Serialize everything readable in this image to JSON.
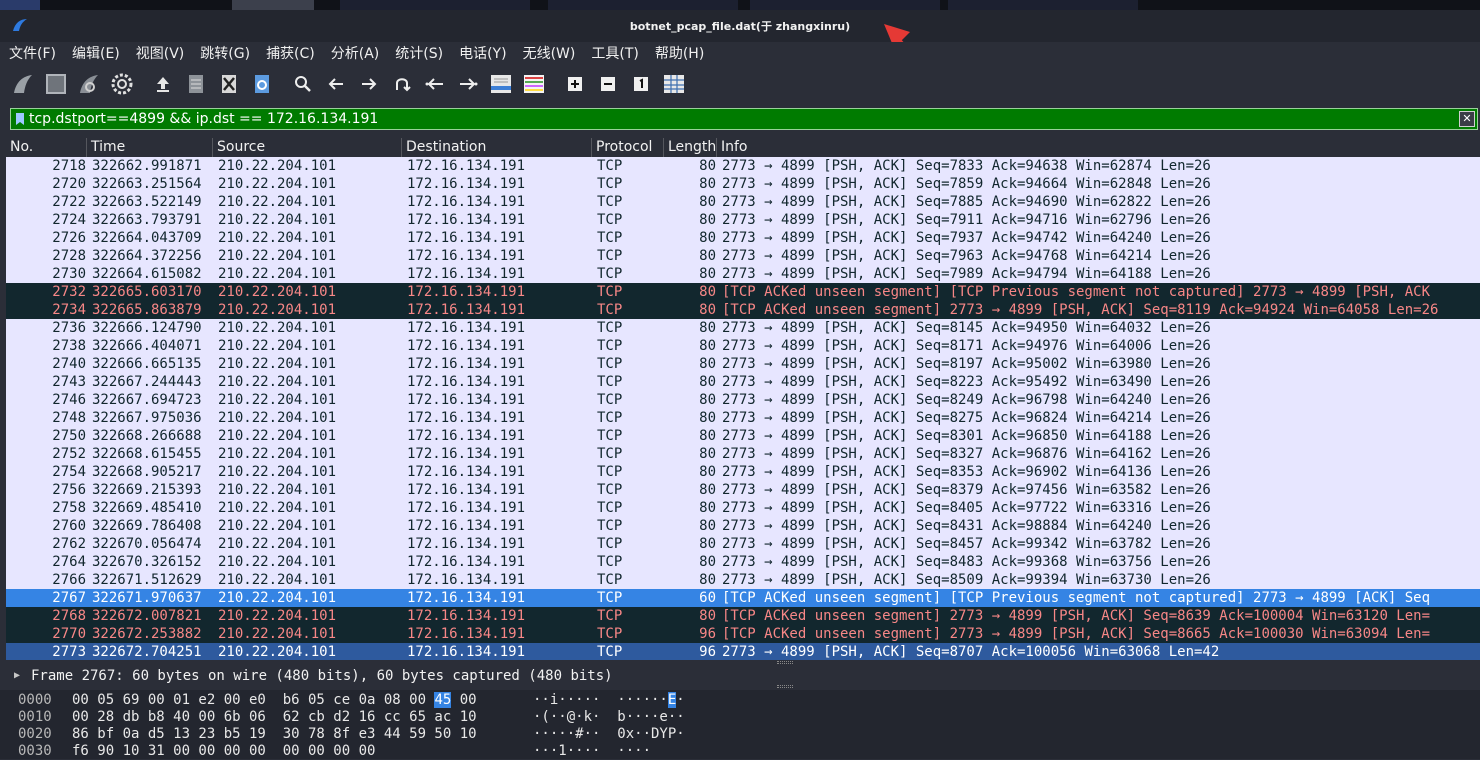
{
  "window": {
    "title": "botnet_pcap_file.dat(于 zhangxinru)"
  },
  "menu": [
    "文件(F)",
    "编辑(E)",
    "视图(V)",
    "跳转(G)",
    "捕获(C)",
    "分析(A)",
    "统计(S)",
    "电话(Y)",
    "无线(W)",
    "工具(T)",
    "帮助(H)"
  ],
  "toolbar": {
    "icons": [
      "shark-fin-start-icon",
      "stop-square-icon",
      "restart-fin-icon",
      "capture-options-gear-icon",
      "open-upload-icon",
      "file-save-icon",
      "close-file-icon",
      "reload-icon",
      "search-icon",
      "go-back-icon",
      "go-forward-icon",
      "go-to-packet-icon",
      "go-first-icon",
      "go-last-icon",
      "autoscroll-icon",
      "colorize-icon",
      "zoom-in-icon",
      "zoom-out-icon",
      "normal-size-icon",
      "resize-columns-icon"
    ]
  },
  "filter": {
    "value": "tcp.dstport==4899 && ip.dst == 172.16.134.191"
  },
  "columns": {
    "no": "No.",
    "time": "Time",
    "source": "Source",
    "destination": "Destination",
    "protocol": "Protocol",
    "length": "Length",
    "info": "Info"
  },
  "colors": {
    "normal_bg": "#e7e6ff",
    "bad_bg": "#12272e",
    "bad_fg": "#f78787",
    "selected_bg": "#3584e4",
    "filter_ok": "#007b00"
  },
  "packets": [
    {
      "no": "2718",
      "time": "322662.991871",
      "src": "210.22.204.101",
      "dst": "172.16.134.191",
      "proto": "TCP",
      "len": "80",
      "info": "2773 → 4899 [PSH, ACK] Seq=7833 Ack=94638 Win=62874 Len=26",
      "style": "normal"
    },
    {
      "no": "2720",
      "time": "322663.251564",
      "src": "210.22.204.101",
      "dst": "172.16.134.191",
      "proto": "TCP",
      "len": "80",
      "info": "2773 → 4899 [PSH, ACK] Seq=7859 Ack=94664 Win=62848 Len=26",
      "style": "normal"
    },
    {
      "no": "2722",
      "time": "322663.522149",
      "src": "210.22.204.101",
      "dst": "172.16.134.191",
      "proto": "TCP",
      "len": "80",
      "info": "2773 → 4899 [PSH, ACK] Seq=7885 Ack=94690 Win=62822 Len=26",
      "style": "normal"
    },
    {
      "no": "2724",
      "time": "322663.793791",
      "src": "210.22.204.101",
      "dst": "172.16.134.191",
      "proto": "TCP",
      "len": "80",
      "info": "2773 → 4899 [PSH, ACK] Seq=7911 Ack=94716 Win=62796 Len=26",
      "style": "normal"
    },
    {
      "no": "2726",
      "time": "322664.043709",
      "src": "210.22.204.101",
      "dst": "172.16.134.191",
      "proto": "TCP",
      "len": "80",
      "info": "2773 → 4899 [PSH, ACK] Seq=7937 Ack=94742 Win=64240 Len=26",
      "style": "normal"
    },
    {
      "no": "2728",
      "time": "322664.372256",
      "src": "210.22.204.101",
      "dst": "172.16.134.191",
      "proto": "TCP",
      "len": "80",
      "info": "2773 → 4899 [PSH, ACK] Seq=7963 Ack=94768 Win=64214 Len=26",
      "style": "normal"
    },
    {
      "no": "2730",
      "time": "322664.615082",
      "src": "210.22.204.101",
      "dst": "172.16.134.191",
      "proto": "TCP",
      "len": "80",
      "info": "2773 → 4899 [PSH, ACK] Seq=7989 Ack=94794 Win=64188 Len=26",
      "style": "normal"
    },
    {
      "no": "2732",
      "time": "322665.603170",
      "src": "210.22.204.101",
      "dst": "172.16.134.191",
      "proto": "TCP",
      "len": "80",
      "info": "[TCP ACKed unseen segment] [TCP Previous segment not captured] 2773 → 4899 [PSH, ACK",
      "style": "bad"
    },
    {
      "no": "2734",
      "time": "322665.863879",
      "src": "210.22.204.101",
      "dst": "172.16.134.191",
      "proto": "TCP",
      "len": "80",
      "info": "[TCP ACKed unseen segment] 2773 → 4899 [PSH, ACK] Seq=8119 Ack=94924 Win=64058 Len=26",
      "style": "bad"
    },
    {
      "no": "2736",
      "time": "322666.124790",
      "src": "210.22.204.101",
      "dst": "172.16.134.191",
      "proto": "TCP",
      "len": "80",
      "info": "2773 → 4899 [PSH, ACK] Seq=8145 Ack=94950 Win=64032 Len=26",
      "style": "normal"
    },
    {
      "no": "2738",
      "time": "322666.404071",
      "src": "210.22.204.101",
      "dst": "172.16.134.191",
      "proto": "TCP",
      "len": "80",
      "info": "2773 → 4899 [PSH, ACK] Seq=8171 Ack=94976 Win=64006 Len=26",
      "style": "normal"
    },
    {
      "no": "2740",
      "time": "322666.665135",
      "src": "210.22.204.101",
      "dst": "172.16.134.191",
      "proto": "TCP",
      "len": "80",
      "info": "2773 → 4899 [PSH, ACK] Seq=8197 Ack=95002 Win=63980 Len=26",
      "style": "normal"
    },
    {
      "no": "2743",
      "time": "322667.244443",
      "src": "210.22.204.101",
      "dst": "172.16.134.191",
      "proto": "TCP",
      "len": "80",
      "info": "2773 → 4899 [PSH, ACK] Seq=8223 Ack=95492 Win=63490 Len=26",
      "style": "normal"
    },
    {
      "no": "2746",
      "time": "322667.694723",
      "src": "210.22.204.101",
      "dst": "172.16.134.191",
      "proto": "TCP",
      "len": "80",
      "info": "2773 → 4899 [PSH, ACK] Seq=8249 Ack=96798 Win=64240 Len=26",
      "style": "normal"
    },
    {
      "no": "2748",
      "time": "322667.975036",
      "src": "210.22.204.101",
      "dst": "172.16.134.191",
      "proto": "TCP",
      "len": "80",
      "info": "2773 → 4899 [PSH, ACK] Seq=8275 Ack=96824 Win=64214 Len=26",
      "style": "normal"
    },
    {
      "no": "2750",
      "time": "322668.266688",
      "src": "210.22.204.101",
      "dst": "172.16.134.191",
      "proto": "TCP",
      "len": "80",
      "info": "2773 → 4899 [PSH, ACK] Seq=8301 Ack=96850 Win=64188 Len=26",
      "style": "normal"
    },
    {
      "no": "2752",
      "time": "322668.615455",
      "src": "210.22.204.101",
      "dst": "172.16.134.191",
      "proto": "TCP",
      "len": "80",
      "info": "2773 → 4899 [PSH, ACK] Seq=8327 Ack=96876 Win=64162 Len=26",
      "style": "normal"
    },
    {
      "no": "2754",
      "time": "322668.905217",
      "src": "210.22.204.101",
      "dst": "172.16.134.191",
      "proto": "TCP",
      "len": "80",
      "info": "2773 → 4899 [PSH, ACK] Seq=8353 Ack=96902 Win=64136 Len=26",
      "style": "normal"
    },
    {
      "no": "2756",
      "time": "322669.215393",
      "src": "210.22.204.101",
      "dst": "172.16.134.191",
      "proto": "TCP",
      "len": "80",
      "info": "2773 → 4899 [PSH, ACK] Seq=8379 Ack=97456 Win=63582 Len=26",
      "style": "normal"
    },
    {
      "no": "2758",
      "time": "322669.485410",
      "src": "210.22.204.101",
      "dst": "172.16.134.191",
      "proto": "TCP",
      "len": "80",
      "info": "2773 → 4899 [PSH, ACK] Seq=8405 Ack=97722 Win=63316 Len=26",
      "style": "normal"
    },
    {
      "no": "2760",
      "time": "322669.786408",
      "src": "210.22.204.101",
      "dst": "172.16.134.191",
      "proto": "TCP",
      "len": "80",
      "info": "2773 → 4899 [PSH, ACK] Seq=8431 Ack=98884 Win=64240 Len=26",
      "style": "normal"
    },
    {
      "no": "2762",
      "time": "322670.056474",
      "src": "210.22.204.101",
      "dst": "172.16.134.191",
      "proto": "TCP",
      "len": "80",
      "info": "2773 → 4899 [PSH, ACK] Seq=8457 Ack=99342 Win=63782 Len=26",
      "style": "normal"
    },
    {
      "no": "2764",
      "time": "322670.326152",
      "src": "210.22.204.101",
      "dst": "172.16.134.191",
      "proto": "TCP",
      "len": "80",
      "info": "2773 → 4899 [PSH, ACK] Seq=8483 Ack=99368 Win=63756 Len=26",
      "style": "normal"
    },
    {
      "no": "2766",
      "time": "322671.512629",
      "src": "210.22.204.101",
      "dst": "172.16.134.191",
      "proto": "TCP",
      "len": "80",
      "info": "2773 → 4899 [PSH, ACK] Seq=8509 Ack=99394 Win=63730 Len=26",
      "style": "normal"
    },
    {
      "no": "2767",
      "time": "322671.970637",
      "src": "210.22.204.101",
      "dst": "172.16.134.191",
      "proto": "TCP",
      "len": "60",
      "info": "[TCP ACKed unseen segment] [TCP Previous segment not captured] 2773 → 4899 [ACK] Seq",
      "style": "sel"
    },
    {
      "no": "2768",
      "time": "322672.007821",
      "src": "210.22.204.101",
      "dst": "172.16.134.191",
      "proto": "TCP",
      "len": "80",
      "info": "[TCP ACKed unseen segment] 2773 → 4899 [PSH, ACK] Seq=8639 Ack=100004 Win=63120 Len=",
      "style": "bad"
    },
    {
      "no": "2770",
      "time": "322672.253882",
      "src": "210.22.204.101",
      "dst": "172.16.134.191",
      "proto": "TCP",
      "len": "96",
      "info": "[TCP ACKed unseen segment] 2773 → 4899 [PSH, ACK] Seq=8665 Ack=100030 Win=63094 Len=",
      "style": "bad"
    },
    {
      "no": "2773",
      "time": "322672.704251",
      "src": "210.22.204.101",
      "dst": "172.16.134.191",
      "proto": "TCP",
      "len": "96",
      "info": "2773 → 4899 [PSH, ACK] Seq=8707 Ack=100056 Win=63068 Len=42",
      "style": "sel2"
    }
  ],
  "detail": {
    "line": "Frame 2767: 60 bytes on wire (480 bits), 60 bytes captured (480 bits)"
  },
  "hex": [
    {
      "off": "0000",
      "pre": "00 05 69 00 01 e2 00 e0  b6 05 ce 0a 08 00 ",
      "hi": "45",
      "post": " 00",
      "ascii_pre": "··i·····  ······",
      "ascii_hi": "E",
      "ascii_post": "·"
    },
    {
      "off": "0010",
      "pre": "00 28 db b8 40 00 6b 06  62 cb d2 16 cc 65 ac 10",
      "hi": "",
      "post": "",
      "ascii_pre": "·(··@·k·  b····e··",
      "ascii_hi": "",
      "ascii_post": ""
    },
    {
      "off": "0020",
      "pre": "86 bf 0a d5 13 23 b5 19  30 78 8f e3 44 59 50 10",
      "hi": "",
      "post": "",
      "ascii_pre": "·····#··  0x··DYP·",
      "ascii_hi": "",
      "ascii_post": ""
    },
    {
      "off": "0030",
      "pre": "f6 90 10 31 00 00 00 00  00 00 00 00",
      "hi": "",
      "post": "",
      "ascii_pre": "···1····  ····",
      "ascii_hi": "",
      "ascii_post": ""
    }
  ]
}
